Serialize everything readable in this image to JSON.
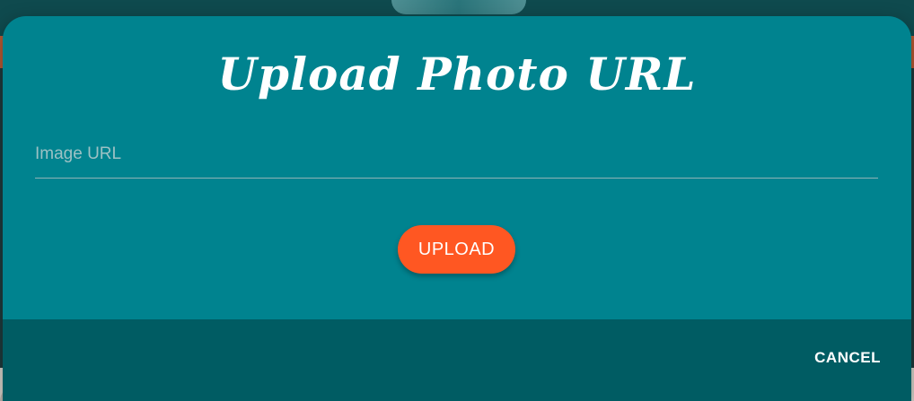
{
  "modal": {
    "title": "Upload Photo URL",
    "url_field": {
      "value": "",
      "placeholder": "Image URL"
    },
    "upload_label": "UPLOAD",
    "cancel_label": "CANCEL"
  },
  "colors": {
    "modal_background": "#00838f",
    "footer_background": "#005c63",
    "upload_button": "#ff5722",
    "text": "#ffffff"
  }
}
